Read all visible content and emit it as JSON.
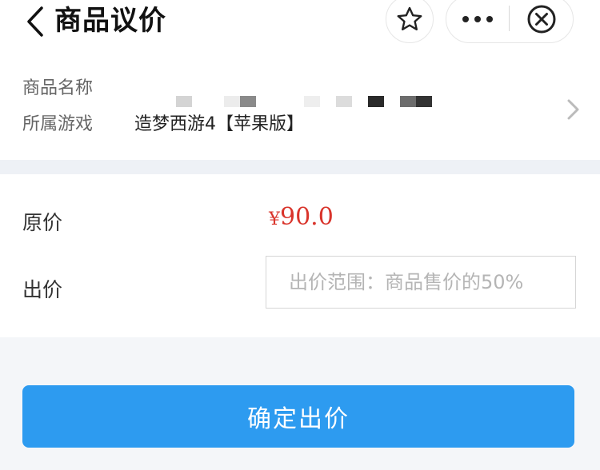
{
  "header": {
    "title": "商品议价",
    "back_icon": "chevron-left-icon",
    "favorite_icon": "star-outline-icon",
    "more_icon": "more-dots-icon",
    "close_icon": "circle-x-icon"
  },
  "product": {
    "name_label": "商品名称",
    "game_label": "所属游戏",
    "game_value": "造梦西游4【苹果版】",
    "name_value_note": "pixelated-blocks",
    "chevron_icon": "chevron-right-icon"
  },
  "pricing": {
    "original_label": "原价",
    "currency_symbol": "¥",
    "original_price": "90.0",
    "bid_label": "出价",
    "bid_placeholder": "出价范围：商品售价的50%",
    "bid_value": ""
  },
  "actions": {
    "confirm_label": "确定出价"
  },
  "colors": {
    "accent": "#2d9bf0",
    "price": "#d9342b",
    "background": "#f4f6f9"
  }
}
